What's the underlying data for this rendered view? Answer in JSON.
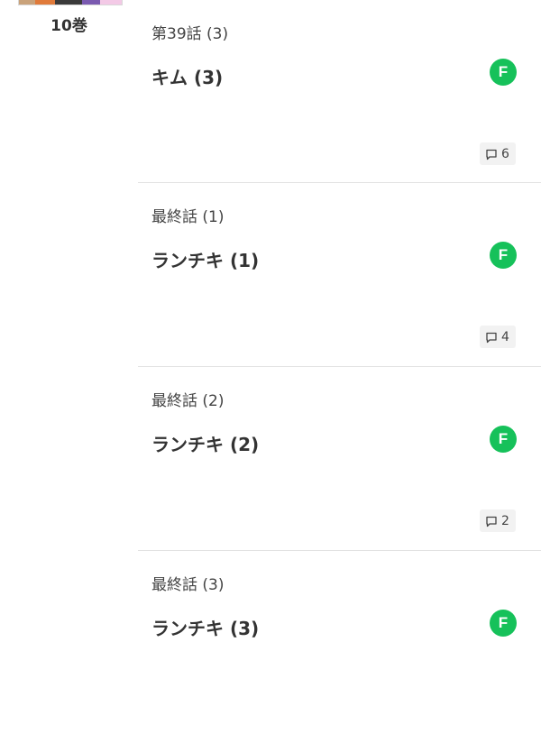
{
  "volume": {
    "label": "10巻"
  },
  "badge_color": "#16c15a",
  "episodes": [
    {
      "title": "第39話 (3)",
      "subtitle": "キム (3)",
      "badge": "F",
      "comments": "6"
    },
    {
      "title": "最終話 (1)",
      "subtitle": "ランチキ (1)",
      "badge": "F",
      "comments": "4"
    },
    {
      "title": "最終話 (2)",
      "subtitle": "ランチキ (2)",
      "badge": "F",
      "comments": "2"
    },
    {
      "title": "最終話 (3)",
      "subtitle": "ランチキ (3)",
      "badge": "F"
    }
  ]
}
